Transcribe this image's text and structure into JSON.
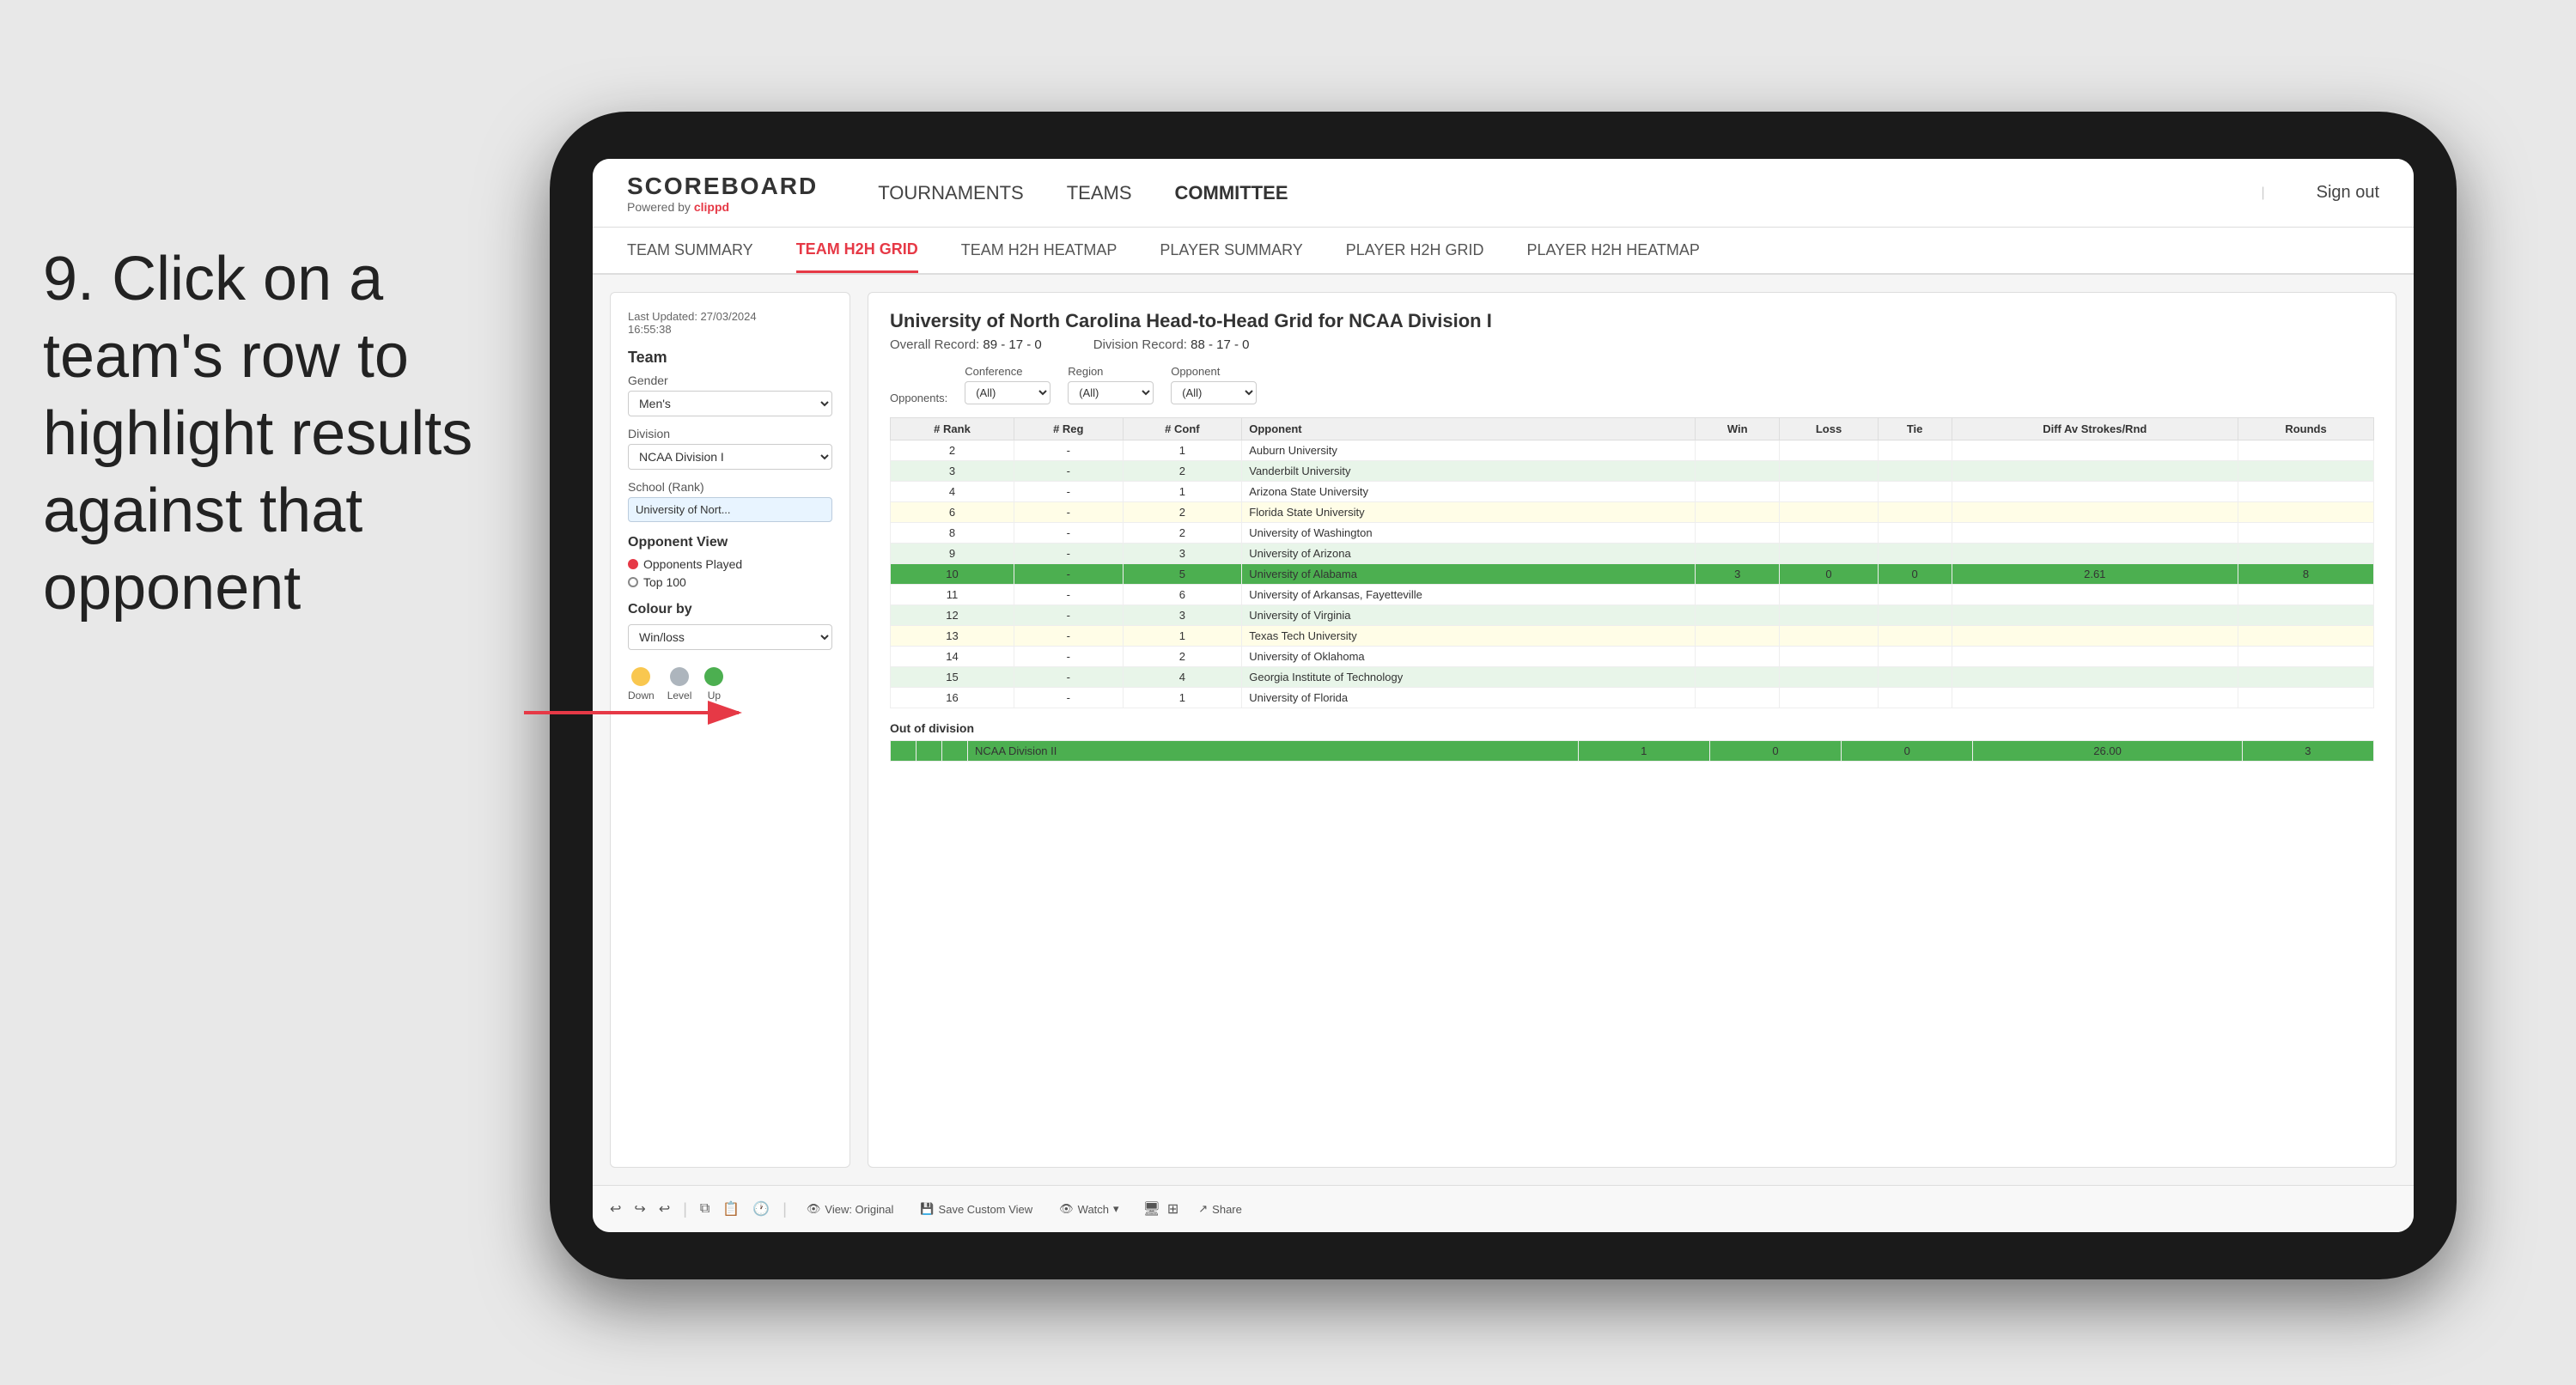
{
  "instruction": {
    "step": "9.",
    "text": "Click on a team's row to highlight results against that opponent"
  },
  "nav": {
    "logo": "SCOREBOARD",
    "logo_powered": "Powered by",
    "logo_brand": "clippd",
    "links": [
      "TOURNAMENTS",
      "TEAMS",
      "COMMITTEE"
    ],
    "sign_out": "Sign out"
  },
  "sub_nav": {
    "links": [
      "TEAM SUMMARY",
      "TEAM H2H GRID",
      "TEAM H2H HEATMAP",
      "PLAYER SUMMARY",
      "PLAYER H2H GRID",
      "PLAYER H2H HEATMAP"
    ],
    "active": "TEAM H2H GRID"
  },
  "sidebar": {
    "last_updated_label": "Last Updated: 27/03/2024",
    "time": "16:55:38",
    "team_title": "Team",
    "gender_label": "Gender",
    "gender_value": "Men's",
    "division_label": "Division",
    "division_value": "NCAA Division I",
    "school_label": "School (Rank)",
    "school_value": "University of Nort...",
    "opponent_view_title": "Opponent View",
    "opponent_view_options": [
      "Opponents Played",
      "Top 100"
    ],
    "opponent_view_selected": "Opponents Played",
    "colour_by_title": "Colour by",
    "colour_by_value": "Win/loss",
    "legend": [
      {
        "label": "Down",
        "color": "#f9c74f"
      },
      {
        "label": "Level",
        "color": "#adb5bd"
      },
      {
        "label": "Up",
        "color": "#4caf50"
      }
    ]
  },
  "grid": {
    "title": "University of North Carolina Head-to-Head Grid for NCAA Division I",
    "overall_record": "89 - 17 - 0",
    "division_record": "88 - 17 - 0",
    "filters": {
      "opponents_label": "Opponents:",
      "conference_label": "Conference",
      "conference_value": "(All)",
      "region_label": "Region",
      "region_value": "(All)",
      "opponent_label": "Opponent",
      "opponent_value": "(All)"
    },
    "columns": [
      "# Rank",
      "# Reg",
      "# Conf",
      "Opponent",
      "Win",
      "Loss",
      "Tie",
      "Diff Av Strokes/Rnd",
      "Rounds"
    ],
    "rows": [
      {
        "rank": "2",
        "reg": "-",
        "conf": "1",
        "opponent": "Auburn University",
        "win": "",
        "loss": "",
        "tie": "",
        "diff": "",
        "rounds": "",
        "style": "normal"
      },
      {
        "rank": "3",
        "reg": "-",
        "conf": "2",
        "opponent": "Vanderbilt University",
        "win": "",
        "loss": "",
        "tie": "",
        "diff": "",
        "rounds": "",
        "style": "light-green"
      },
      {
        "rank": "4",
        "reg": "-",
        "conf": "1",
        "opponent": "Arizona State University",
        "win": "",
        "loss": "",
        "tie": "",
        "diff": "",
        "rounds": "",
        "style": "normal"
      },
      {
        "rank": "6",
        "reg": "-",
        "conf": "2",
        "opponent": "Florida State University",
        "win": "",
        "loss": "",
        "tie": "",
        "diff": "",
        "rounds": "",
        "style": "light-yellow"
      },
      {
        "rank": "8",
        "reg": "-",
        "conf": "2",
        "opponent": "University of Washington",
        "win": "",
        "loss": "",
        "tie": "",
        "diff": "",
        "rounds": "",
        "style": "normal"
      },
      {
        "rank": "9",
        "reg": "-",
        "conf": "3",
        "opponent": "University of Arizona",
        "win": "",
        "loss": "",
        "tie": "",
        "diff": "",
        "rounds": "",
        "style": "light-green"
      },
      {
        "rank": "10",
        "reg": "-",
        "conf": "5",
        "opponent": "University of Alabama",
        "win": "3",
        "loss": "0",
        "tie": "0",
        "diff": "2.61",
        "rounds": "8",
        "style": "highlighted"
      },
      {
        "rank": "11",
        "reg": "-",
        "conf": "6",
        "opponent": "University of Arkansas, Fayetteville",
        "win": "",
        "loss": "",
        "tie": "",
        "diff": "",
        "rounds": "",
        "style": "normal"
      },
      {
        "rank": "12",
        "reg": "-",
        "conf": "3",
        "opponent": "University of Virginia",
        "win": "",
        "loss": "",
        "tie": "",
        "diff": "",
        "rounds": "",
        "style": "light-green"
      },
      {
        "rank": "13",
        "reg": "-",
        "conf": "1",
        "opponent": "Texas Tech University",
        "win": "",
        "loss": "",
        "tie": "",
        "diff": "",
        "rounds": "",
        "style": "light-yellow"
      },
      {
        "rank": "14",
        "reg": "-",
        "conf": "2",
        "opponent": "University of Oklahoma",
        "win": "",
        "loss": "",
        "tie": "",
        "diff": "",
        "rounds": "",
        "style": "normal"
      },
      {
        "rank": "15",
        "reg": "-",
        "conf": "4",
        "opponent": "Georgia Institute of Technology",
        "win": "",
        "loss": "",
        "tie": "",
        "diff": "",
        "rounds": "",
        "style": "light-green"
      },
      {
        "rank": "16",
        "reg": "-",
        "conf": "1",
        "opponent": "University of Florida",
        "win": "",
        "loss": "",
        "tie": "",
        "diff": "",
        "rounds": "",
        "style": "normal"
      }
    ],
    "out_of_division_label": "Out of division",
    "out_of_division_row": {
      "name": "NCAA Division II",
      "win": "1",
      "loss": "0",
      "tie": "0",
      "diff": "26.00",
      "rounds": "3"
    }
  },
  "toolbar": {
    "view_label": "View: Original",
    "save_custom_label": "Save Custom View",
    "watch_label": "Watch",
    "share_label": "Share"
  }
}
